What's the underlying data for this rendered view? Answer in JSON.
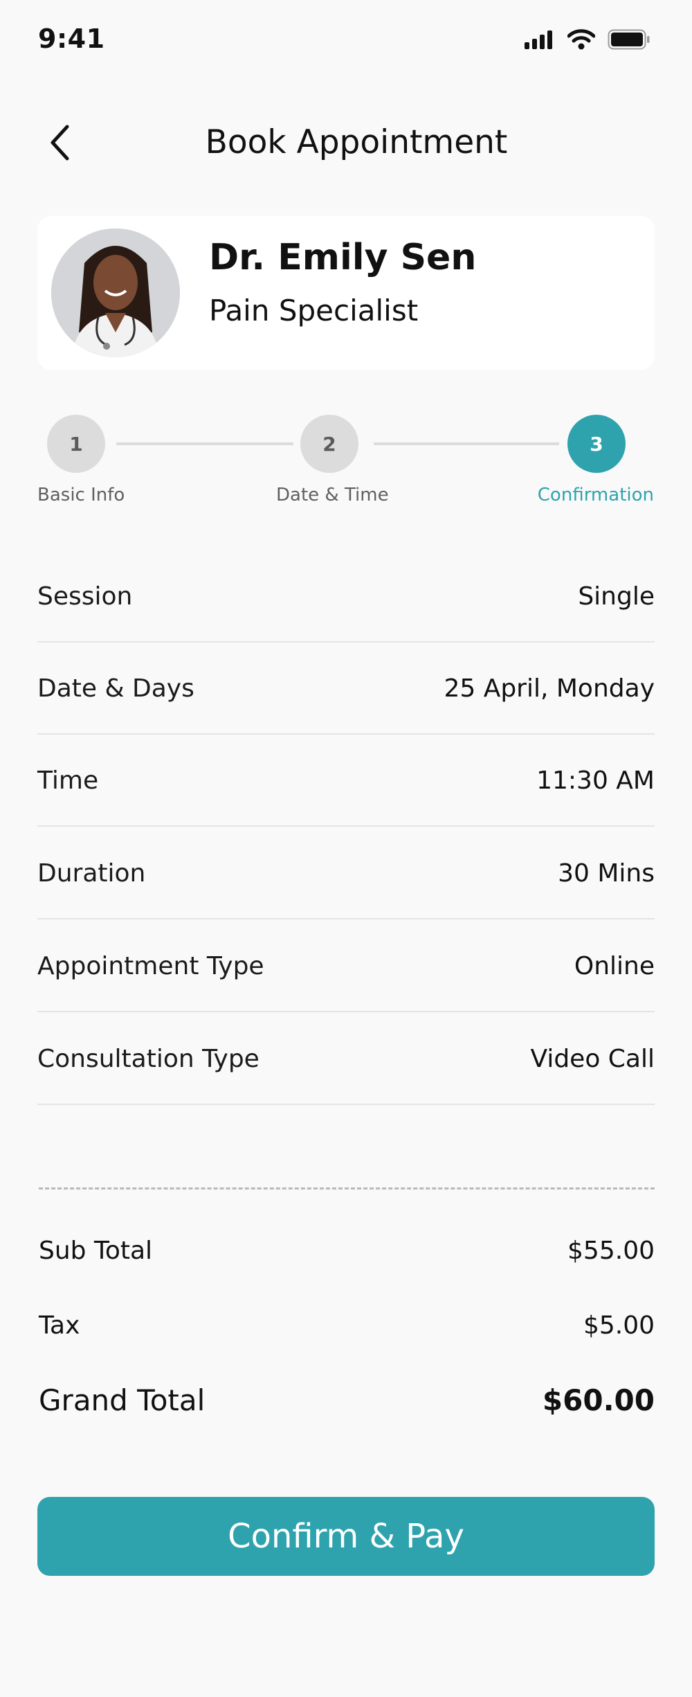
{
  "status_bar": {
    "time": "9:41"
  },
  "header": {
    "title": "Book Appointment"
  },
  "doctor": {
    "name": "Dr. Emily Sen",
    "specialty": "Pain Specialist"
  },
  "stepper": {
    "steps": [
      {
        "number": "1",
        "label": "Basic Info"
      },
      {
        "number": "2",
        "label": "Date & Time"
      },
      {
        "number": "3",
        "label": "Confirmation"
      }
    ],
    "active_step": 3
  },
  "details": [
    {
      "label": "Session",
      "value": "Single"
    },
    {
      "label": "Date & Days",
      "value": "25 April, Monday"
    },
    {
      "label": "Time",
      "value": "11:30 AM"
    },
    {
      "label": "Duration",
      "value": "30 Mins"
    },
    {
      "label": "Appointment Type",
      "value": "Online"
    },
    {
      "label": "Consultation Type",
      "value": "Video Call"
    }
  ],
  "summary": {
    "subtotal": {
      "label": "Sub Total",
      "value": "$55.00"
    },
    "tax": {
      "label": "Tax",
      "value": "$5.00"
    },
    "grand_total": {
      "label": "Grand Total",
      "value": "$60.00"
    }
  },
  "actions": {
    "confirm_label": "Confirm & Pay"
  },
  "colors": {
    "accent": "#2fa3ad",
    "background": "#f9f9f9",
    "inactive_step": "#dcdcdc"
  },
  "icons": [
    "cellular-signal-icon",
    "wifi-icon",
    "battery-icon",
    "back-chevron-icon"
  ]
}
